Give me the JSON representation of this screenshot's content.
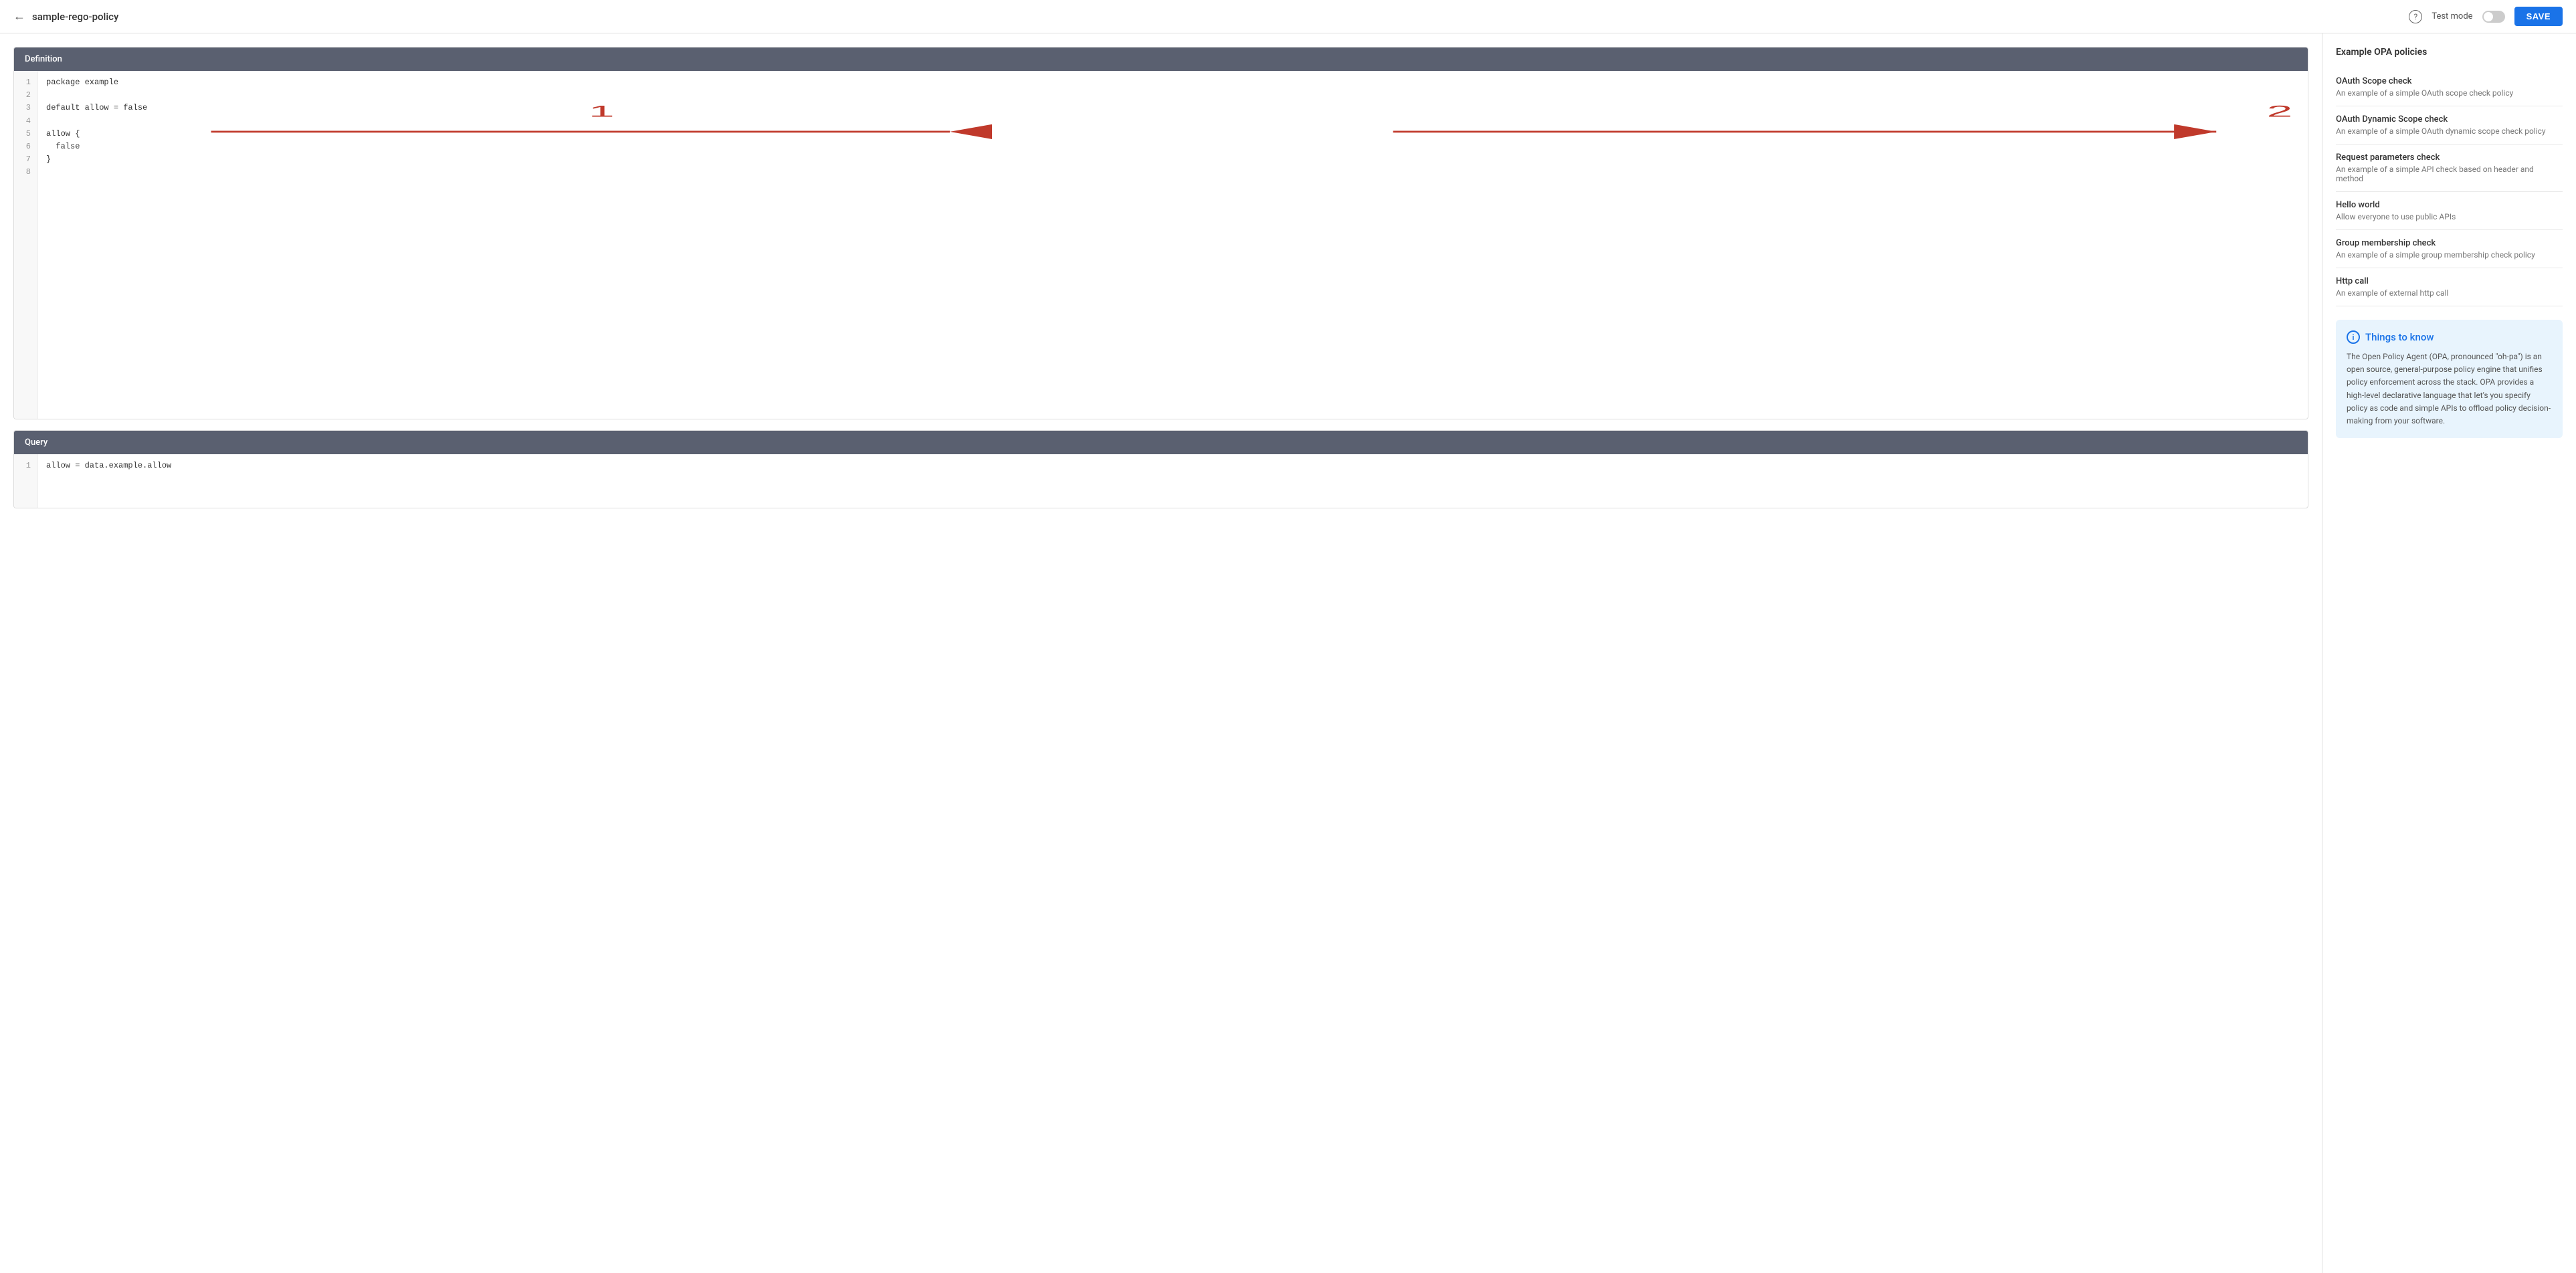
{
  "header": {
    "back_label": "←",
    "title": "sample-rego-policy",
    "help_icon": "?",
    "test_mode_label": "Test mode",
    "save_label": "SAVE"
  },
  "definition_panel": {
    "header": "Definition",
    "code_lines": [
      "package example",
      "",
      "default allow = false",
      "",
      "allow {",
      "  false",
      "}",
      ""
    ],
    "line_count": 8
  },
  "query_panel": {
    "header": "Query",
    "code_lines": [
      "allow = data.example.allow"
    ],
    "line_count": 1
  },
  "sidebar": {
    "title": "Example OPA policies",
    "policies": [
      {
        "title": "OAuth Scope check",
        "desc": "An example of a simple OAuth scope check policy"
      },
      {
        "title": "OAuth Dynamic Scope check",
        "desc": "An example of a simple OAuth dynamic scope check policy"
      },
      {
        "title": "Request parameters check",
        "desc": "An example of a simple API check based on header and method"
      },
      {
        "title": "Hello world",
        "desc": "Allow everyone to use public APIs"
      },
      {
        "title": "Group membership check",
        "desc": "An example of a simple group membership check policy"
      },
      {
        "title": "Http call",
        "desc": "An example of external http call"
      }
    ],
    "things_to_know": {
      "title": "Things to know",
      "text": "The Open Policy Agent (OPA, pronounced \"oh-pa\") is an open source, general-purpose policy engine that unifies policy enforcement across the stack. OPA provides a high-level declarative language that let's you specify policy as code and simple APIs to offload policy decision-making from your software."
    }
  },
  "arrows": {
    "label1": "1",
    "label2": "2",
    "color": "#c0392b"
  }
}
